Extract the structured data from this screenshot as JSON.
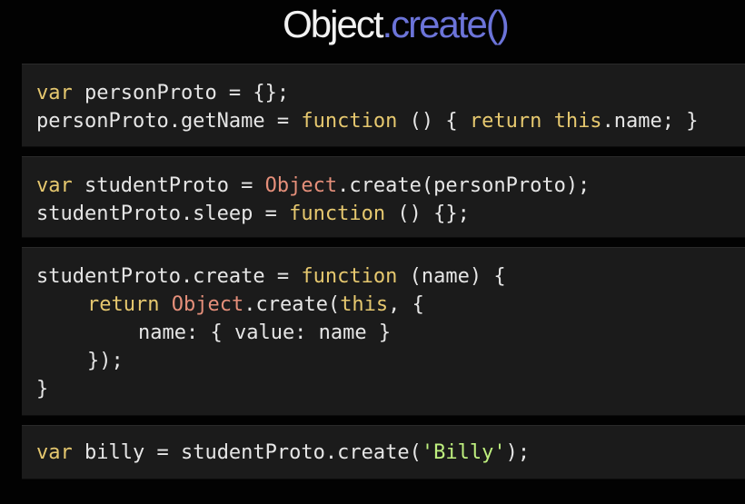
{
  "title": {
    "object_part": "Object",
    "method_part": ".create()"
  },
  "colors": {
    "background": "#020202",
    "code_block": "#1b1b1b",
    "plain_text": "#e6e6e6",
    "keyword": "#e6c86f",
    "builtin_object": "#e58f7a",
    "string": "#bff07f",
    "title_primary": "#f2f2f2",
    "title_accent": "#6c74d9"
  },
  "blocks": [
    {
      "lines": [
        {
          "text": "var personProto = {};",
          "tokens": [
            {
              "t": "var",
              "c": "kw"
            },
            {
              "t": " personProto = {};",
              "c": "pl"
            }
          ]
        },
        {
          "text": "personProto.getName = function () { return this.name; }",
          "tokens": [
            {
              "t": "personProto.getName = ",
              "c": "pl"
            },
            {
              "t": "function",
              "c": "kw"
            },
            {
              "t": " () { ",
              "c": "pl"
            },
            {
              "t": "return this",
              "c": "kw"
            },
            {
              "t": ".name; }",
              "c": "pl"
            }
          ]
        }
      ]
    },
    {
      "lines": [
        {
          "text": "var studentProto = Object.create(personProto);",
          "tokens": [
            {
              "t": "var",
              "c": "kw"
            },
            {
              "t": " studentProto = ",
              "c": "pl"
            },
            {
              "t": "Object",
              "c": "obj"
            },
            {
              "t": ".create(personProto);",
              "c": "pl"
            }
          ]
        },
        {
          "text": "studentProto.sleep = function () {};",
          "tokens": [
            {
              "t": "studentProto.sleep = ",
              "c": "pl"
            },
            {
              "t": "function",
              "c": "kw"
            },
            {
              "t": " () {};",
              "c": "pl"
            }
          ]
        }
      ]
    },
    {
      "lines": [
        {
          "text": "studentProto.create = function (name) {",
          "indent": 0,
          "tokens": [
            {
              "t": "studentProto.create = ",
              "c": "pl"
            },
            {
              "t": "function",
              "c": "kw"
            },
            {
              "t": " (name) {",
              "c": "pl"
            }
          ]
        },
        {
          "text": "return Object.create(this, {",
          "indent": 1,
          "tokens": [
            {
              "t": "return",
              "c": "kw"
            },
            {
              "t": " ",
              "c": "pl"
            },
            {
              "t": "Object",
              "c": "obj"
            },
            {
              "t": ".create(",
              "c": "pl"
            },
            {
              "t": "this",
              "c": "kw"
            },
            {
              "t": ", {",
              "c": "pl"
            }
          ]
        },
        {
          "text": "name: { value: name }",
          "indent": 2,
          "tokens": [
            {
              "t": "name: { value: name }",
              "c": "pl"
            }
          ]
        },
        {
          "text": "});",
          "indent": 1,
          "tokens": [
            {
              "t": "});",
              "c": "pl"
            }
          ]
        },
        {
          "text": "}",
          "indent": 0,
          "tokens": [
            {
              "t": "}",
              "c": "pl"
            }
          ]
        }
      ]
    },
    {
      "lines": [
        {
          "text": "var billy = studentProto.create('Billy');",
          "tokens": [
            {
              "t": "var",
              "c": "kw"
            },
            {
              "t": " billy = studentProto.create(",
              "c": "pl"
            },
            {
              "t": "'Billy'",
              "c": "str"
            },
            {
              "t": ");",
              "c": "pl"
            }
          ]
        }
      ]
    }
  ]
}
